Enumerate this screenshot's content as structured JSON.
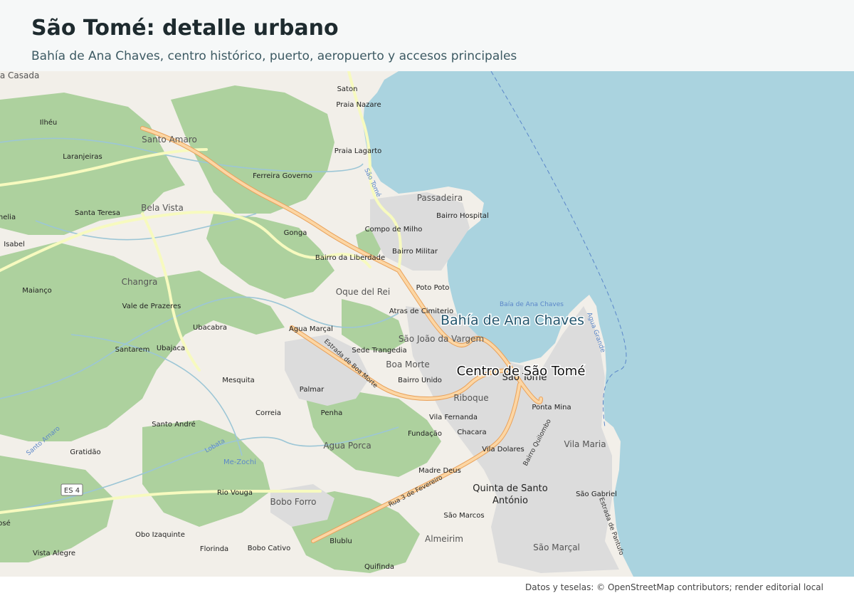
{
  "header": {
    "title": "São Tomé: detalle urbano",
    "subtitle": "Bahía de Ana Chaves, centro histórico, puerto, aeropuerto y accesos principales"
  },
  "map": {
    "featured_labels": {
      "bay": "Bahía de Ana Chaves",
      "center": "Centro de São Tomé"
    },
    "place_labels": [
      "gua Casada",
      "Saton",
      "Praia Nazare",
      "Ilhéu",
      "Santo Amaro",
      "Laranjeiras",
      "Praia Lagarto",
      "Ferreira Governo",
      "Passadeira",
      "Bairro Hospital",
      "Bela Vista",
      "Santa Teresa",
      "nelia",
      "Gonga",
      "Compo de Milho",
      "Isabel",
      "Bairro da Liberdade",
      "Bairro Militar",
      "Changra",
      "Oque del Rei",
      "Maianço",
      "Poto Poto",
      "Vale de Prazeres",
      "Atras de Cimiterio",
      "Ubacabra",
      "Agua Marçal",
      "São João da Vargem",
      "Santarem",
      "Ubajaca",
      "Sede Trangedia",
      "Boa Morte",
      "Mesquita",
      "Bairro Unido",
      "Palmar",
      "São Tomé",
      "Riboque",
      "Correia",
      "Penha",
      "Ponta Mina",
      "Vila Fernanda",
      "Santo André",
      "Fundação",
      "Chacara",
      "Gratidão",
      "Vila Maria",
      "Agua Porca",
      "Vila Dolares",
      "Me-Zochi",
      "Madre Deus",
      "Quinta de Santo António",
      "Rio Vouga",
      "São Gabriel",
      "Bobo Forro",
      "São Marcos",
      "osé",
      "Obo Izaquinte",
      "Almeirim",
      "Vista Alegre",
      "Florinda",
      "Bobo Cativo",
      "São Marçal",
      "Blublu",
      "Quifinda"
    ],
    "road_labels": [
      "ES 4",
      "Estrada de Boa Morte",
      "Rua 3 de Fevereiro",
      "Bairro Quilombo",
      "Estrada de Pantufo",
      "Agua Grande",
      "São Tomé",
      "Lobata",
      "Santo Amaro",
      "Baía de Ana Chaves"
    ],
    "colors": {
      "sea": "#aad3df",
      "forest": "#add19e",
      "land": "#f2efe9",
      "urban": "#dddddd",
      "major_road": "#fcd6a4",
      "secondary_road": "#f7fabf",
      "water_line": "#9cc6d6"
    }
  },
  "footer": {
    "attribution": "Datos y teselas: © OpenStreetMap contributors; render editorial local"
  }
}
